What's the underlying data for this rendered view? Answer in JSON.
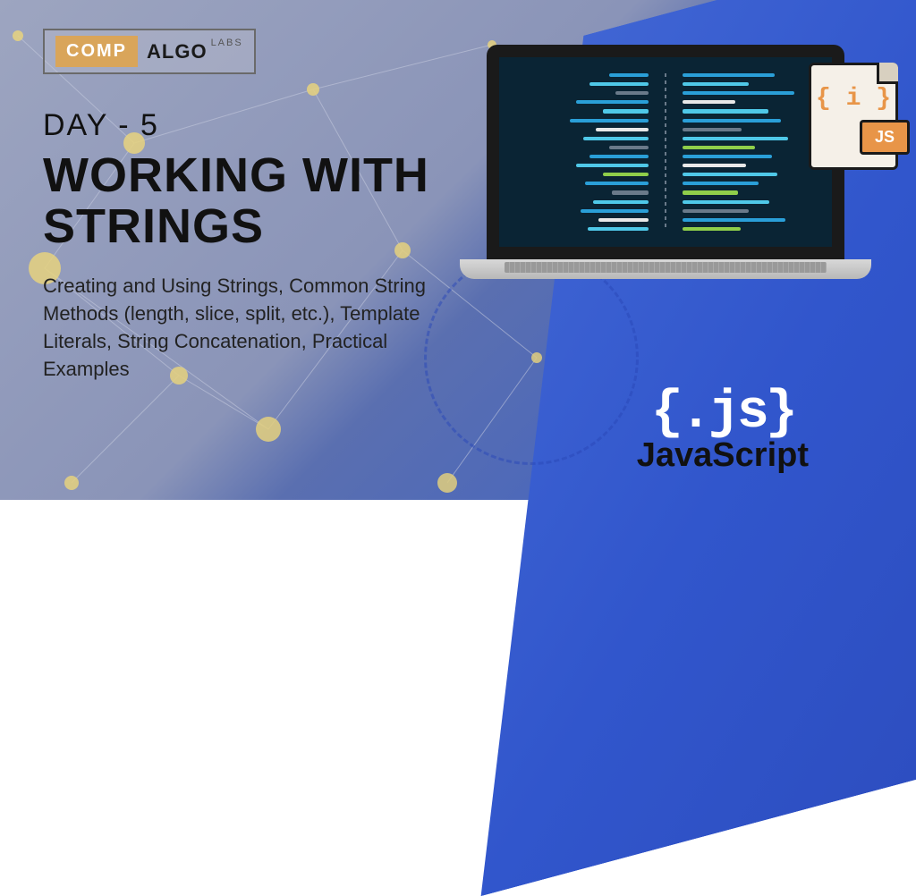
{
  "logo": {
    "comp": "COMP",
    "algo": "ALGO",
    "labs": "LABS"
  },
  "day_label": "DAY - 5",
  "title": "WORKING WITH STRINGS",
  "description": "Creating and Using Strings, Common String Methods (length, slice, split, etc.), Template Literals, String Concatenation, Practical Examples",
  "file_icon": {
    "braces": "{ i }",
    "badge": "JS"
  },
  "js_logo": {
    "braces": "{.js}",
    "text": "JavaScript"
  },
  "colors": {
    "code_blue": "#2a9fd8",
    "code_cyan": "#4fc8e8",
    "code_white": "#e8e8e8",
    "code_green": "#8fce4a",
    "code_grey": "#6a7a8a"
  }
}
